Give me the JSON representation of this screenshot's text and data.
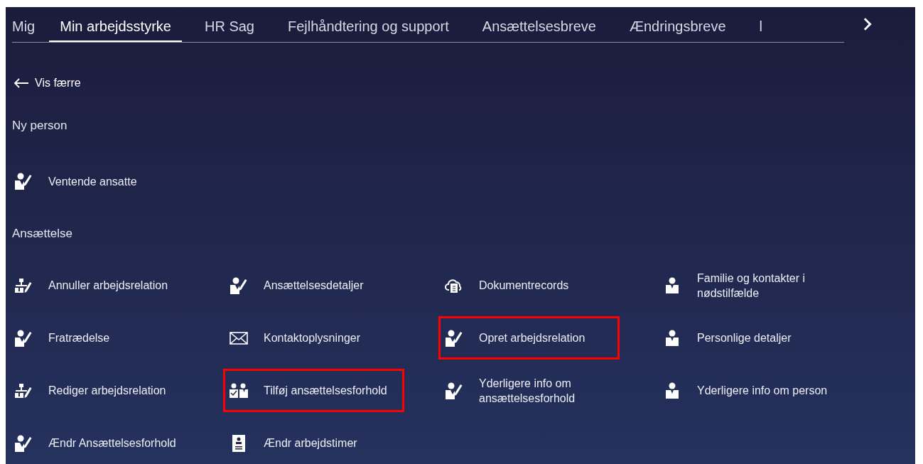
{
  "tabs": [
    {
      "label": "Mig",
      "selected": false
    },
    {
      "label": "Min arbejdsstyrke",
      "selected": true
    },
    {
      "label": "HR Sag",
      "selected": false
    },
    {
      "label": "Fejlhåndtering og support",
      "selected": false
    },
    {
      "label": "Ansættelsesbreve",
      "selected": false
    },
    {
      "label": "Ændringsbreve",
      "selected": false
    },
    {
      "label": "l",
      "selected": false
    }
  ],
  "back_link": {
    "label": "Vis færre"
  },
  "sections": [
    {
      "title": "Ny person",
      "items": [
        {
          "label": "Ventende ansatte",
          "kind": "person-pencil",
          "highlighted": false
        }
      ]
    },
    {
      "title": "Ansættelse",
      "items": [
        {
          "label": "Annuller arbejdsrelation",
          "kind": "org-pencil",
          "highlighted": false
        },
        {
          "label": "Ansættelsesdetaljer",
          "kind": "person-pencil",
          "highlighted": false
        },
        {
          "label": "Dokumentrecords",
          "kind": "cloud-doc",
          "highlighted": false
        },
        {
          "label": "Familie og kontakter i nødstilfælde",
          "kind": "person",
          "highlighted": false
        },
        {
          "label": "Fratrædelse",
          "kind": "person-pencil",
          "highlighted": false
        },
        {
          "label": "Kontaktoplysninger",
          "kind": "envelope",
          "highlighted": false
        },
        {
          "label": "Opret arbejdsrelation",
          "kind": "person-pencil",
          "highlighted": true
        },
        {
          "label": "Personlige detaljer",
          "kind": "person",
          "highlighted": false
        },
        {
          "label": "Rediger arbejdsrelation",
          "kind": "org-pencil",
          "highlighted": false
        },
        {
          "label": "Tilføj ansættelsesforhold",
          "kind": "two-persons",
          "highlighted": true
        },
        {
          "label": "Yderligere info om ansættelsesforhold",
          "kind": "person-pencil",
          "highlighted": false
        },
        {
          "label": "Yderligere info om person",
          "kind": "person",
          "highlighted": false
        },
        {
          "label": "Ændr Ansættelsesforhold",
          "kind": "person-pencil",
          "highlighted": false
        },
        {
          "label": "Ændr arbejdstimer",
          "kind": "badge",
          "highlighted": false
        }
      ]
    }
  ]
}
